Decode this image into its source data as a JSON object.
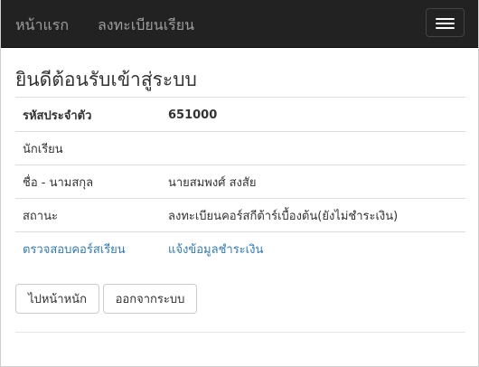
{
  "navbar": {
    "home_label": "หน้าแรก",
    "register_label": "ลงทะเบียนเรียน",
    "toggle_icon": "hamburger-menu-icon"
  },
  "page": {
    "title": "ยินดีต้อนรับเข้าสู่ระบบ"
  },
  "info_table": {
    "rows": [
      {
        "key": "รหัสประจำตัว",
        "value": "651000"
      },
      {
        "key": "นักเรียน",
        "value": ""
      },
      {
        "key": "ชื่อ - นามสกุล",
        "value": "นายสมพงศ์ สงสัย"
      },
      {
        "key": "สถานะ",
        "value": "ลงทะเบียนคอร์สกีต้าร์เบื้องต้น(ยังไม่ชำระเงิน)"
      },
      {
        "key": "ตรวจสอบคอร์สเรียน",
        "value": "แจ้งข้อมูลชำระเงิน"
      }
    ]
  },
  "actions": {
    "home_button": "ไปหน้าหนัก",
    "logout_button": "ออกจากระบบ"
  },
  "colors": {
    "navbar_bg": "#222222",
    "nav_text": "#9d9d9d",
    "link": "#337ab7"
  }
}
